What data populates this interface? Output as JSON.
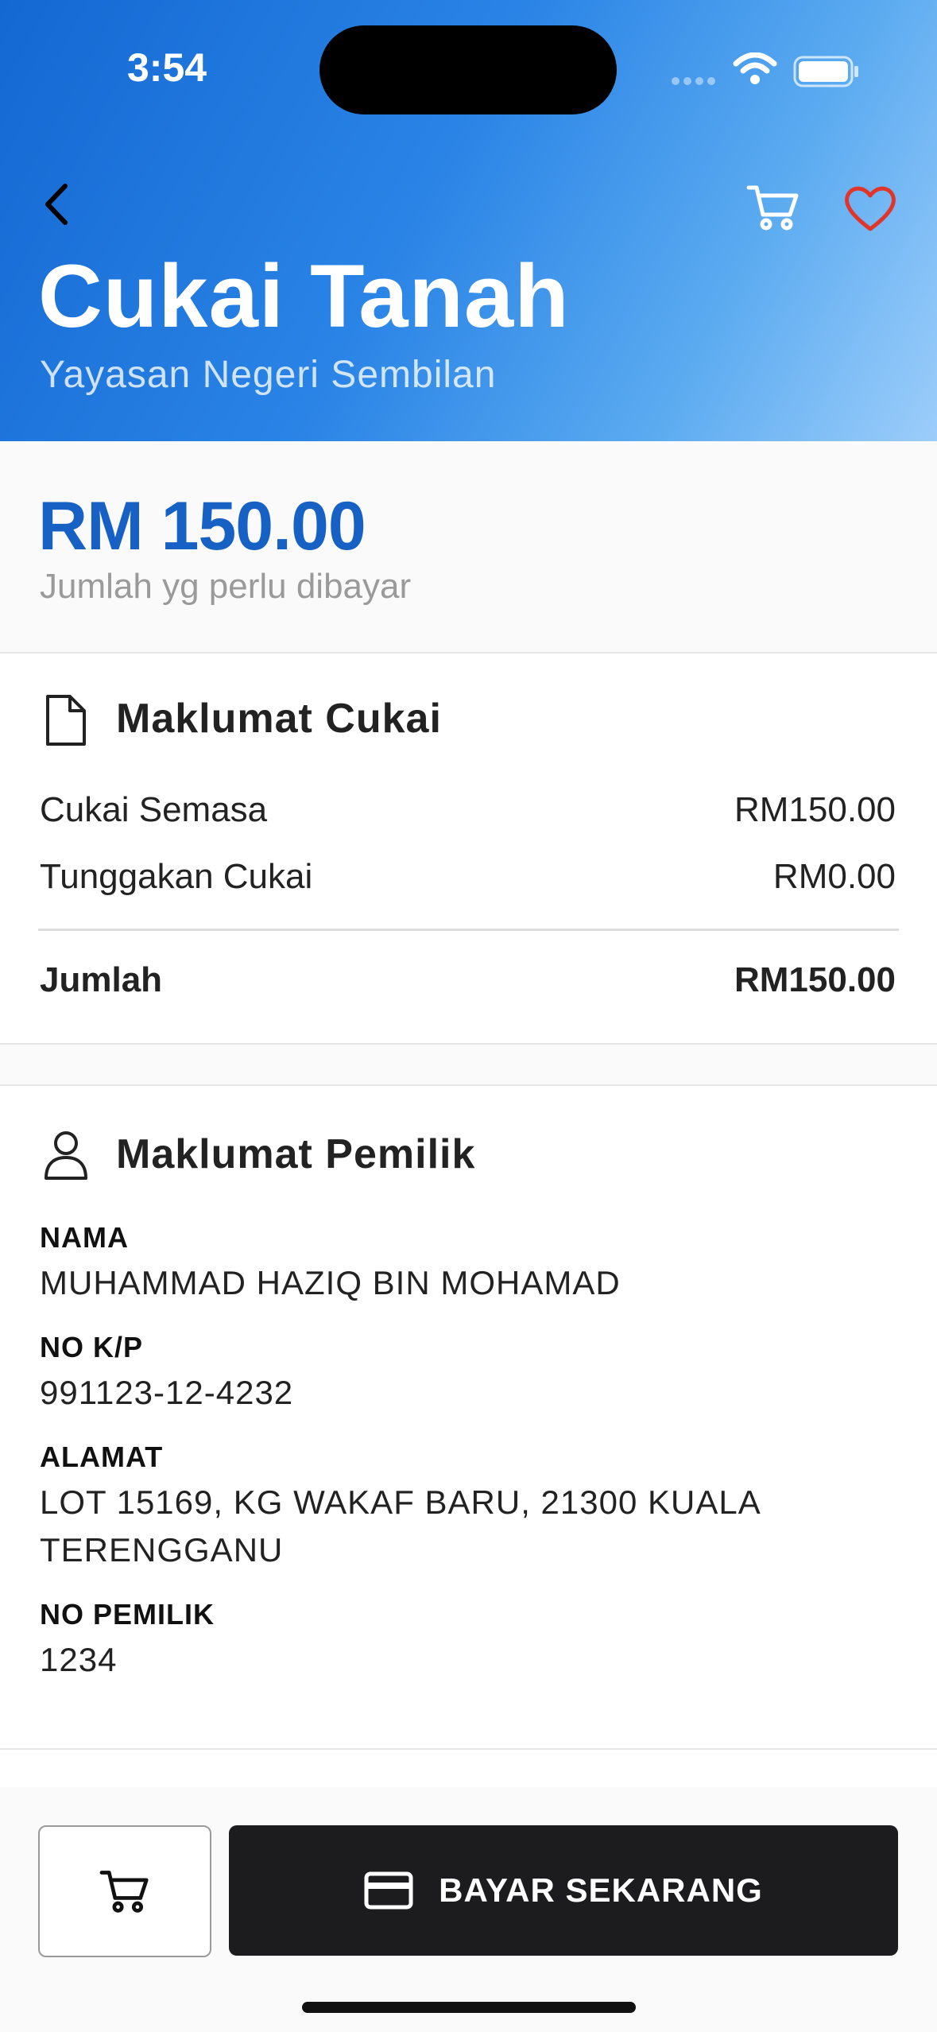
{
  "status_bar": {
    "time": "3:54"
  },
  "header": {
    "title": "Cukai Tanah",
    "subtitle": "Yayasan Negeri Sembilan",
    "icons": [
      "back-chevron-icon",
      "cart-icon",
      "heart-icon"
    ],
    "heart_color": "#e0352b"
  },
  "amount": {
    "value": "RM 150.00",
    "label": "Jumlah yg perlu dibayar",
    "color": "#1761c4"
  },
  "tax_info": {
    "title": "Maklumat Cukai",
    "icon": "document-icon",
    "rows": [
      {
        "label": "Cukai Semasa",
        "value": "RM150.00"
      },
      {
        "label": "Tunggakan Cukai",
        "value": "RM0.00"
      }
    ],
    "total": {
      "label": "Jumlah",
      "value": "RM150.00"
    }
  },
  "owner_info": {
    "title": "Maklumat Pemilik",
    "icon": "user-icon",
    "fields": [
      {
        "label": "NAMA",
        "value": "MUHAMMAD HAZIQ BIN MOHAMAD"
      },
      {
        "label": "NO K/P",
        "value": "991123-12-4232"
      },
      {
        "label": "ALAMAT",
        "value": "LOT 15169, KG WAKAF BARU, 21300 KUALA TERENGGANU"
      },
      {
        "label": "NO PEMILIK",
        "value": "1234"
      }
    ]
  },
  "bottom_bar": {
    "cart_icon": "cart-icon",
    "pay_icon": "credit-card-icon",
    "pay_label": "BAYAR SEKARANG"
  }
}
